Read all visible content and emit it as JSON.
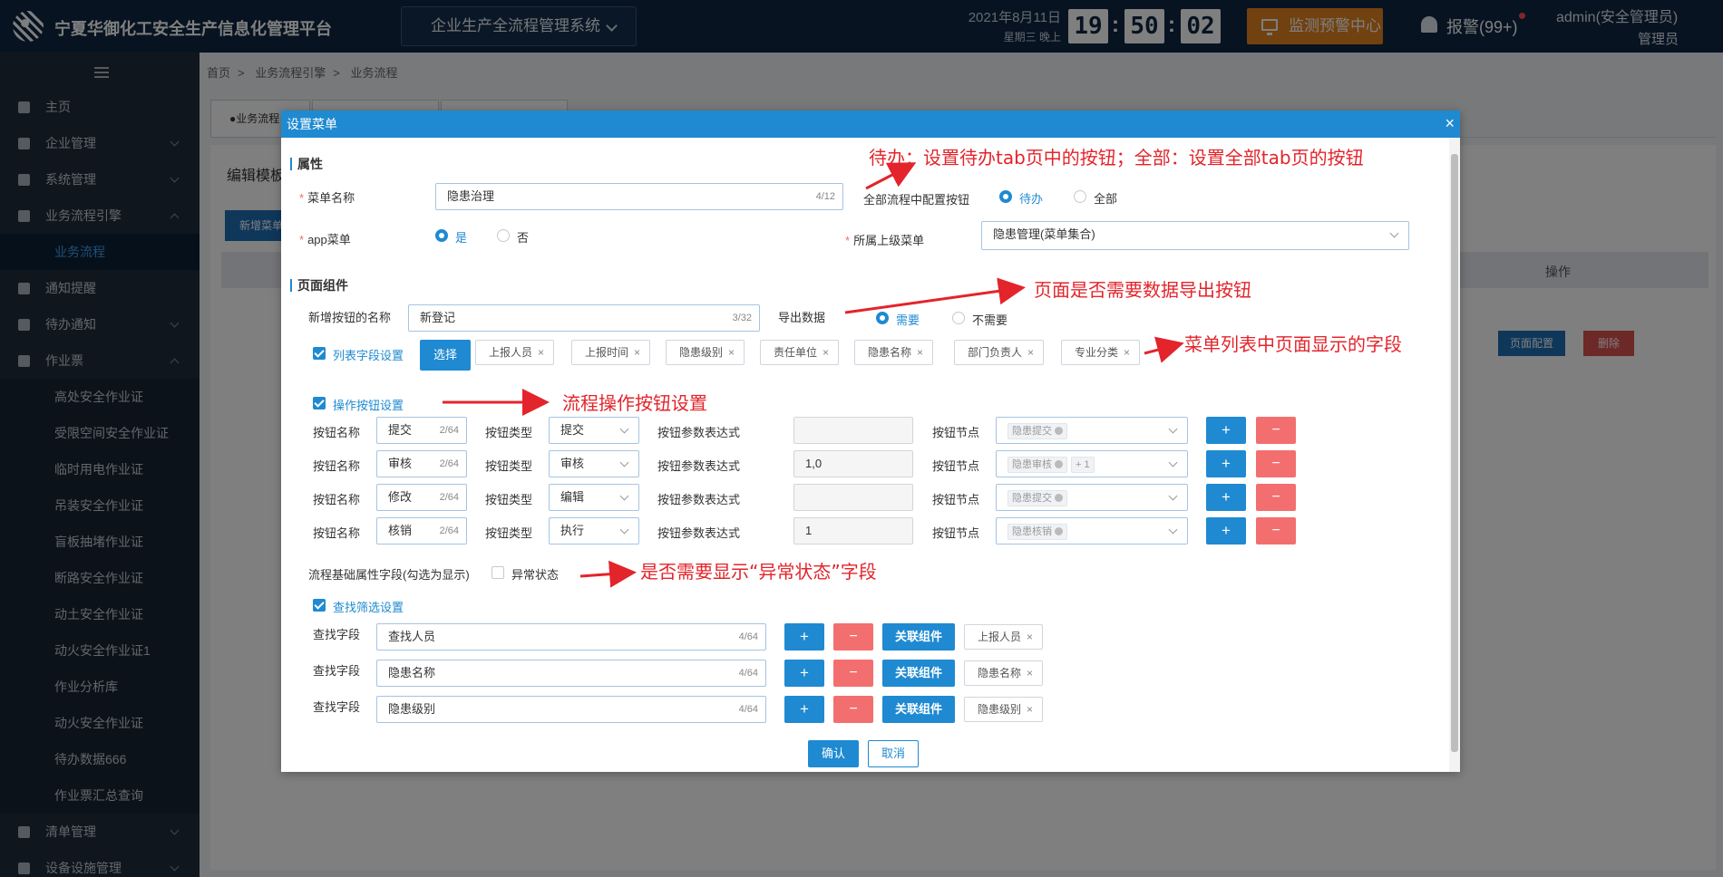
{
  "header": {
    "title": "宁夏华御化工安全生产信息化管理平台",
    "system_select": "企业生产全流程管理系统",
    "date": "2021年8月11日",
    "weekday": "星期三 晚上",
    "clock": {
      "h": "19",
      "m": "50",
      "s": "02"
    },
    "monitor_btn": "监测预警中心",
    "alarm": "报警(99+)",
    "user": "admin(安全管理员)",
    "role": "管理员"
  },
  "sidebar": {
    "items": [
      {
        "label": "主页",
        "icon": "home-icon"
      },
      {
        "label": "企业管理",
        "icon": "building-icon"
      },
      {
        "label": "系统管理",
        "icon": "gear-icon"
      },
      {
        "label": "业务流程引擎",
        "icon": "flow-icon"
      },
      {
        "label": "业务流程"
      },
      {
        "label": "通知提醒",
        "icon": "mail-icon"
      },
      {
        "label": "待办通知",
        "icon": "mail-icon"
      },
      {
        "label": "作业票",
        "icon": "ticket-icon"
      },
      {
        "label": "高处安全作业证"
      },
      {
        "label": "受限空间安全作业证"
      },
      {
        "label": "临时用电作业证"
      },
      {
        "label": "吊装安全作业证"
      },
      {
        "label": "盲板抽堵作业证"
      },
      {
        "label": "断路安全作业证"
      },
      {
        "label": "动土安全作业证"
      },
      {
        "label": "动火安全作业证1"
      },
      {
        "label": "作业分析库"
      },
      {
        "label": "动火安全作业证"
      },
      {
        "label": "待办数据666"
      },
      {
        "label": "作业票汇总查询"
      },
      {
        "label": "清单管理",
        "icon": "list-icon"
      },
      {
        "label": "设备设施管理",
        "icon": "device-icon"
      }
    ]
  },
  "breadcrumb": [
    "首页",
    "业务流程引擎",
    "业务流程"
  ],
  "background": {
    "tab1": "●业务流程",
    "title": "编辑模板",
    "new_btn": "新增菜单",
    "op_header": "操作",
    "cfg_btn": "页面配置",
    "del_btn": "删除"
  },
  "dialog": {
    "title": "设置菜单",
    "section_props": "属性",
    "menu_name_label": "菜单名称",
    "menu_name_value": "隐患治理",
    "menu_name_count": "4/12",
    "flow_btn_label": "全部流程中配置按钮",
    "flow_opt_todo": "待办",
    "flow_opt_all": "全部",
    "app_menu_label": "app菜单",
    "app_yes": "是",
    "app_no": "否",
    "parent_menu_label": "所属上级菜单",
    "parent_menu_value": "隐患管理(菜单集合)",
    "section_components": "页面组件",
    "new_btn_name_label": "新增按钮的名称",
    "new_btn_name_value": "新登记",
    "new_btn_name_count": "3/32",
    "export_label": "导出数据",
    "export_need": "需要",
    "export_noneed": "不需要",
    "list_fields_label": "列表字段设置",
    "select_btn": "选择",
    "list_fields": [
      "上报人员",
      "上报时间",
      "隐患级别",
      "责任单位",
      "隐患名称",
      "部门负责人",
      "专业分类"
    ],
    "op_btn_label": "操作按钮设置",
    "op_rows": [
      {
        "name": "提交",
        "count": "2/64",
        "type": "提交",
        "expr": "",
        "nodes": [
          "隐患提交"
        ],
        "more": ""
      },
      {
        "name": "审核",
        "count": "2/64",
        "type": "审核",
        "expr": "1,0",
        "nodes": [
          "隐患审核"
        ],
        "more": "+ 1"
      },
      {
        "name": "修改",
        "count": "2/64",
        "type": "编辑",
        "expr": "",
        "nodes": [
          "隐患提交"
        ],
        "more": ""
      },
      {
        "name": "核销",
        "count": "2/64",
        "type": "执行",
        "expr": "1",
        "nodes": [
          "隐患核销"
        ],
        "more": ""
      }
    ],
    "row_name_label": "按钮名称",
    "row_type_label": "按钮类型",
    "row_expr_label": "按钮参数表达式",
    "row_node_label": "按钮节点",
    "plus": "+",
    "minus": "−",
    "base_field_label": "流程基础属性字段(勾选为显示)",
    "abnormal_label": "异常状态",
    "search_label": "查找筛选设置",
    "search_field_label": "查找字段",
    "link_btn": "关联组件",
    "search_rows": [
      {
        "value": "查找人员",
        "count": "4/64",
        "tag": "上报人员"
      },
      {
        "value": "隐患名称",
        "count": "4/64",
        "tag": "隐患名称"
      },
      {
        "value": "隐患级别",
        "count": "4/64",
        "tag": "隐患级别"
      }
    ],
    "confirm_btn": "确认",
    "cancel_btn": "取消"
  },
  "annotations": {
    "a1": "待办：设置待办tab页中的按钮；全部：设置全部tab页的按钮",
    "a2": "页面是否需要数据导出按钮",
    "a3": "菜单列表中页面显示的字段",
    "a4": "流程操作按钮设置",
    "a5": "是否需要显示“异常状态”字段"
  },
  "colors": {
    "topbar": "#0f2742",
    "sidebar": "#1f2d3d",
    "accent": "#1f8ad1",
    "danger": "#f36f6f",
    "annotation": "#e3242b",
    "monitor": "#e38320"
  }
}
